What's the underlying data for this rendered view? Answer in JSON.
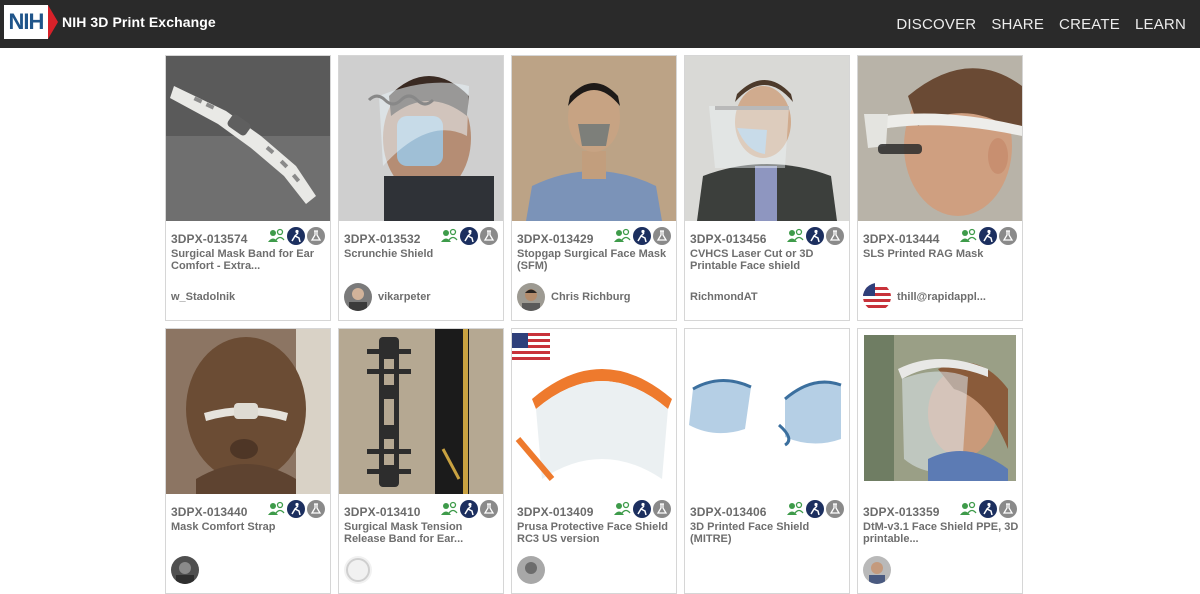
{
  "header": {
    "logo_mark": "NIH",
    "logo_text": "NIH 3D Print Exchange",
    "nav": [
      "DISCOVER",
      "SHARE",
      "CREATE",
      "LEARN"
    ]
  },
  "icon_names": [
    "community-icon",
    "accessibility-icon",
    "lab-flask-icon"
  ],
  "colors": {
    "topbar": "#2a2a2a",
    "community_green": "#3e9b4a",
    "badge_navy": "#1c2f5f",
    "badge_gray": "#8a8a8a",
    "nih_red": "#d72129",
    "nih_blue": "#20558a"
  },
  "cards": [
    {
      "id": "3DPX-013574",
      "title": "Surgical Mask Band for Ear Comfort - Extra...",
      "author": "w_Stadolnik",
      "avatar": ""
    },
    {
      "id": "3DPX-013532",
      "title": "Scrunchie Shield",
      "author": "vikarpeter",
      "avatar": "photo"
    },
    {
      "id": "3DPX-013429",
      "title": "Stopgap Surgical Face Mask (SFM)",
      "author": "Chris Richburg",
      "avatar": "photo"
    },
    {
      "id": "3DPX-013456",
      "title": "CVHCS Laser Cut or 3D Printable Face shield",
      "author": "RichmondAT",
      "avatar": ""
    },
    {
      "id": "3DPX-013444",
      "title": "SLS Printed RAG Mask",
      "author": "thill@rapidappl...",
      "avatar": "flag"
    },
    {
      "id": "3DPX-013440",
      "title": "Mask Comfort Strap",
      "author": "",
      "avatar": "photo"
    },
    {
      "id": "3DPX-013410",
      "title": "Surgical Mask Tension Release Band for Ear...",
      "author": "",
      "avatar": "light"
    },
    {
      "id": "3DPX-013409",
      "title": "Prusa Protective Face Shield RC3 US version",
      "author": "",
      "avatar": "photo"
    },
    {
      "id": "3DPX-013406",
      "title": "3D Printed Face Shield (MITRE)",
      "author": "",
      "avatar": ""
    },
    {
      "id": "3DPX-013359",
      "title": "DtM-v3.1 Face Shield PPE, 3D printable...",
      "author": "",
      "avatar": "photo"
    }
  ]
}
